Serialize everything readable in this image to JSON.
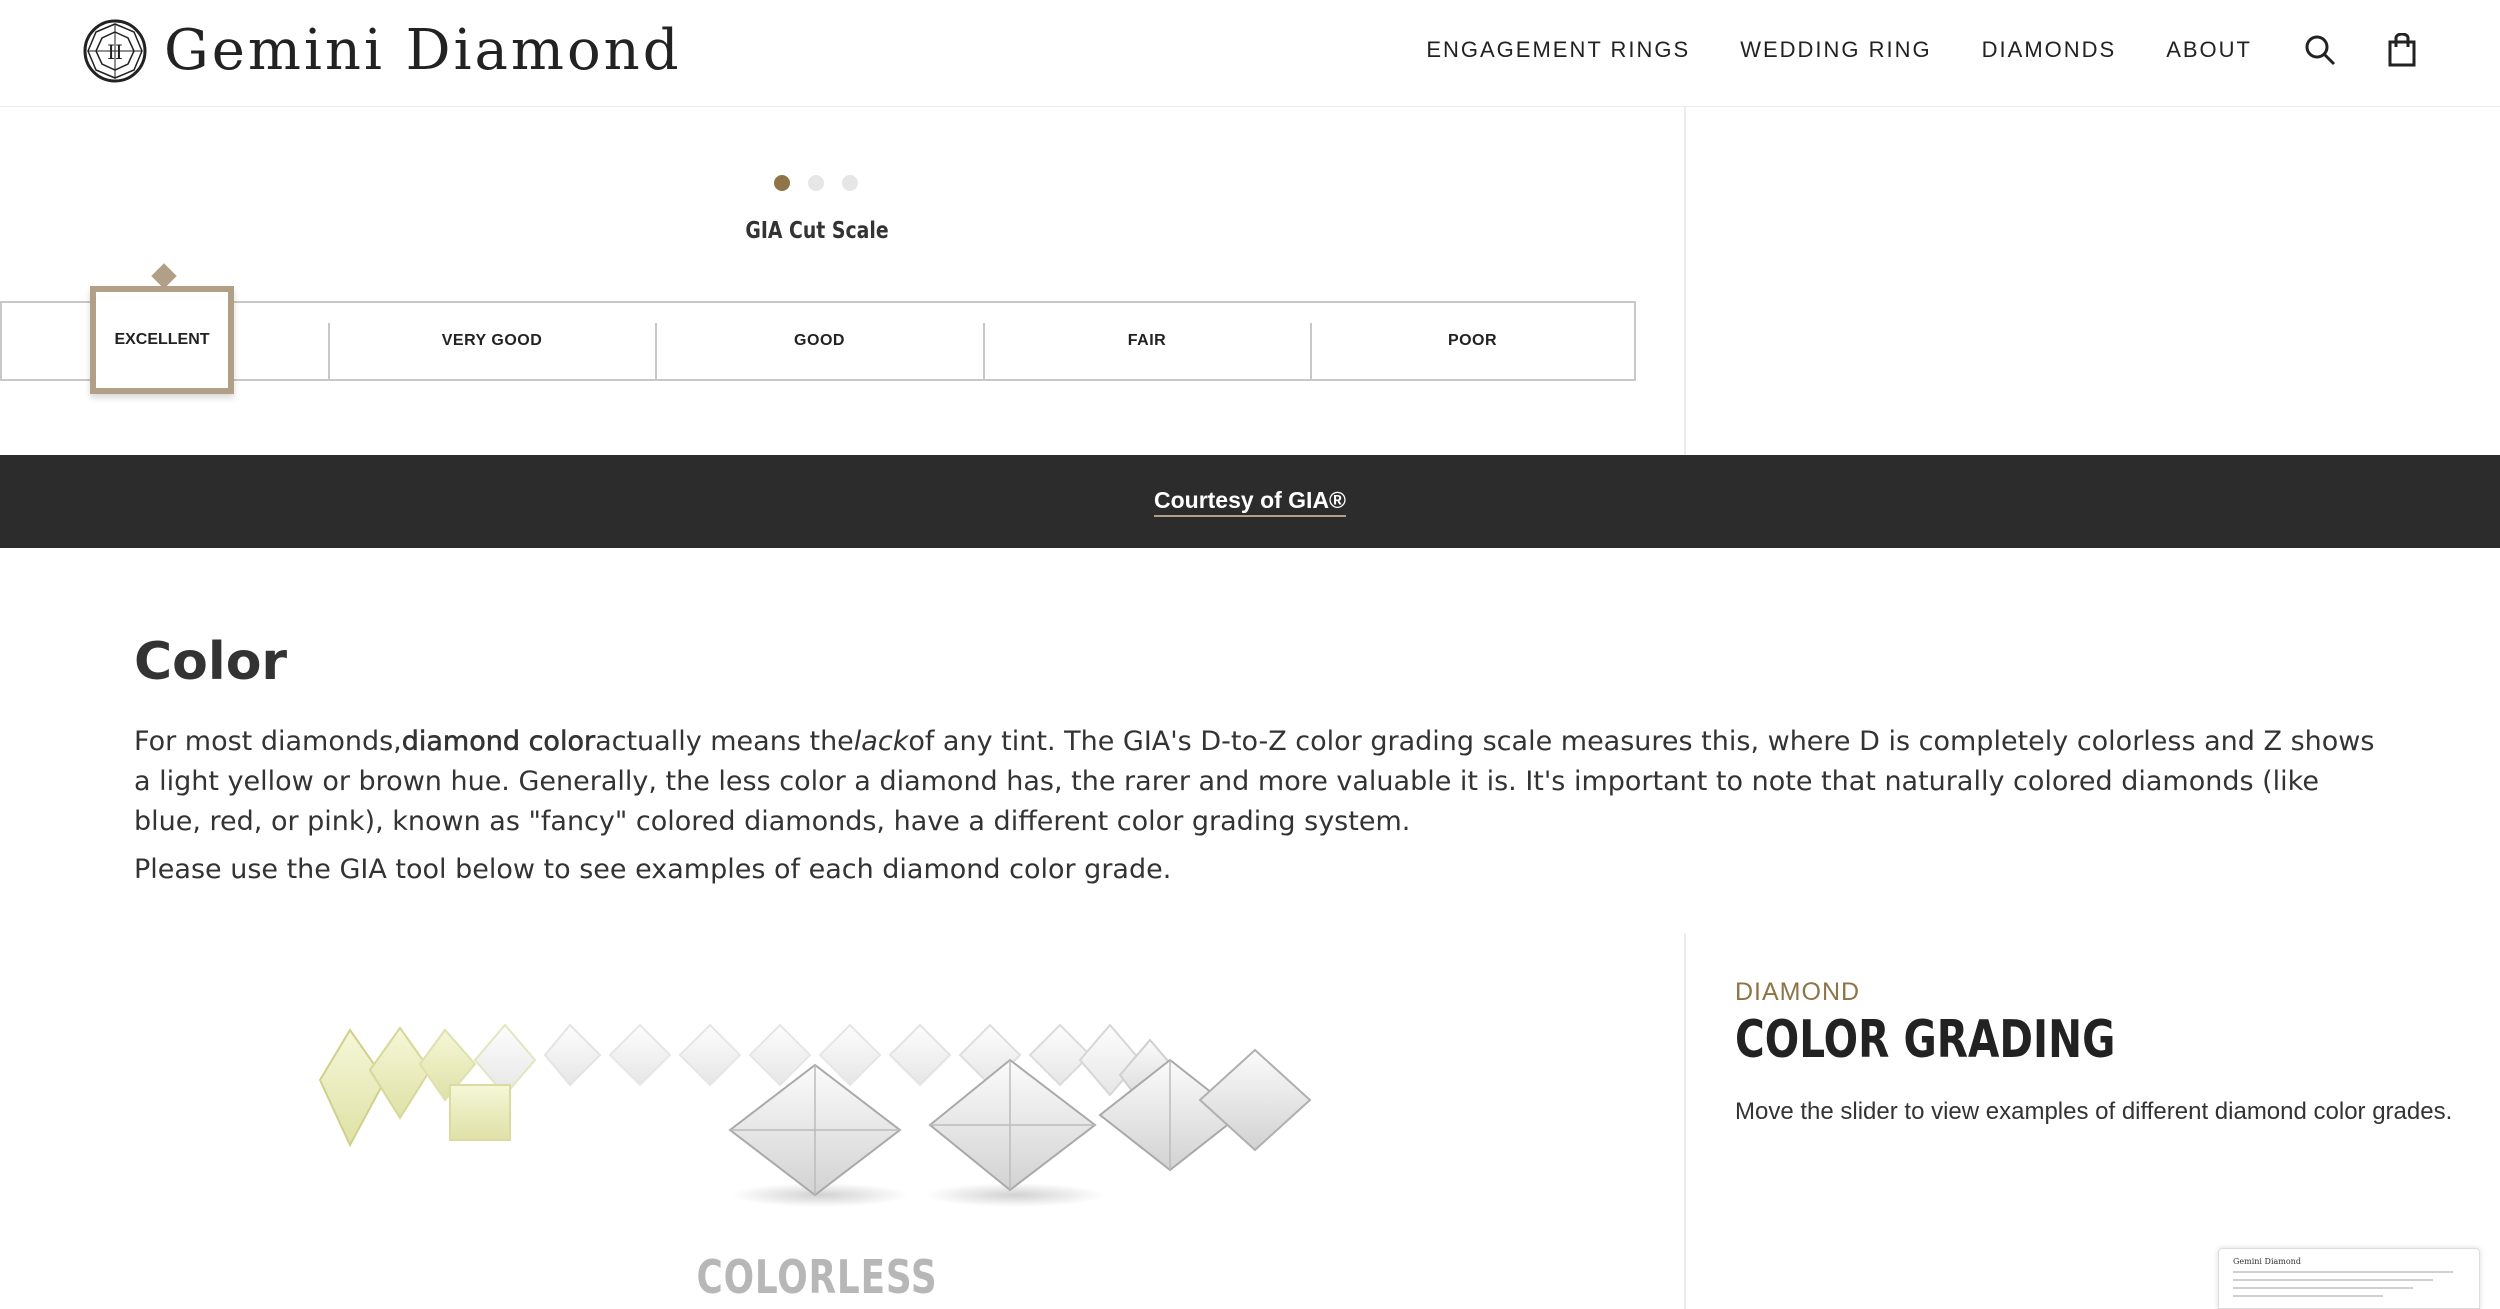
{
  "header": {
    "brand": "Gemini Diamond",
    "nav": [
      "ENGAGEMENT RINGS",
      "WEDDING RING",
      "DIAMONDS",
      "ABOUT"
    ],
    "icons": [
      "search-icon",
      "shopping-bag-icon"
    ]
  },
  "cut_scale": {
    "title": "GIA Cut Scale",
    "carousel_dots": 3,
    "active_dot": 1,
    "grades": [
      "EXCELLENT",
      "VERY GOOD",
      "GOOD",
      "FAIR",
      "POOR"
    ],
    "selected_grade": "EXCELLENT"
  },
  "courtesy": {
    "link_text": "Courtesy of GIA®"
  },
  "color_section": {
    "title": "Color",
    "body_part1": "For most diamonds,",
    "body_bold": "diamond color",
    "body_part2": "actually means the",
    "body_italic": "lack",
    "body_part3": "of any tint. The GIA's D-to-Z color grading scale measures this, where D is completely colorless and Z shows a light yellow or brown hue. Generally, the less color a diamond has, the rarer and more valuable it is. It's important to note that naturally colored diamonds (like blue, red, or pink), known as \"fancy\" colored diamonds, have a different color grading system.",
    "note": "Please use the GIA tool below to see examples of each diamond color grade."
  },
  "color_grading": {
    "kicker": "DIAMOND",
    "title": "COLOR GRADING",
    "description": "Move the slider to view examples of different diamond color grades.",
    "current_grade_label": "COLORLESS (D)"
  },
  "colors": {
    "accent": "#8e7447",
    "selector": "#b29f88",
    "dark_band": "#2c2c2c"
  }
}
